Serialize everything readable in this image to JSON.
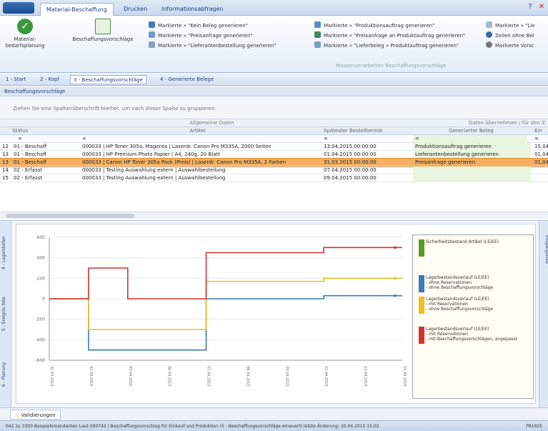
{
  "titlebar": {
    "app_button": "",
    "tabs": [
      "Material-Beschaffung",
      "Drucken",
      "Informationsabfragen"
    ],
    "help_icon": "help-icon",
    "close_icon": "close-icon"
  },
  "ribbon": {
    "big_buttons": [
      {
        "label": "Material-\nbedarfsplanung",
        "icon": "check-icon",
        "color": "#3a9a3a"
      },
      {
        "label": "Beschaffungsvorschläge",
        "icon": "proposal-icon",
        "color": "#4a8a3a"
      }
    ],
    "commands_col1": [
      "Markierte » \"Kein Beleg generieren\"",
      "Markierte » \"Preisanfrage generieren\"",
      "Markierte » \"Lieferantenbestellung generieren\""
    ],
    "commands_col2": [
      "Markierte » \"Produktionsauftrag generieren\"",
      "Markierte » \"Preisanfrage an Produktauftrag generieren\"",
      "Markierte » \"Lieferbeleg » Produktauftrag generieren\""
    ],
    "commands_col3": [
      "Markierte » \"Lie",
      "Zeilen ohne Bel",
      "Markierte Vorsc"
    ],
    "group_caption": "Massenverarbeiten Beschaffungsvorschläge"
  },
  "navbar": {
    "tabs": [
      "1 - Start",
      "2 - Kopf",
      "3 - Beschaffungsvorschläge",
      "4 - Generierte Belege"
    ],
    "active": 2
  },
  "section_title": "Beschaffungsvorschläge",
  "group_hint": "Ziehen Sie eine Spaltenüberschrift hierher, um nach dieser Spalte zu gruppieren.",
  "grid": {
    "band_headers": [
      "Allgemeine Daten",
      "Daten übernehmen / für den Z"
    ],
    "columns": [
      "Status",
      "Artikel",
      "Spätester Bestelltermin",
      "Generierter Beleg",
      "Ein"
    ],
    "filter_symbols": [
      "=",
      "=",
      "=",
      "=",
      "="
    ],
    "rows": [
      {
        "num": "12",
        "status": "01 - Beschaff",
        "article": "000033 | HP Toner 305a, Magenta | Laserdr. Canon Pro M335A, 2000 Seiten",
        "date": "13.04.2015 00:00:00",
        "doc": "Produktionsauftrag generieren",
        "ein": "15.04."
      },
      {
        "num": "13",
        "status": "01 - Beschaff",
        "article": "000033 | HP Premium Photo Papier | A4, 240g, 20 Blatt",
        "date": "01.04.2015 00:00:00",
        "doc": "Lieferantenbestellung generieren",
        "ein": "01.04."
      },
      {
        "num": "13",
        "status": "01 - Beschaff",
        "article": "000033 | Canon HP Toner 305a Pack (Preis) | Laserdr. Canon Pro M335A, 2 Farben",
        "date": "31.03.2015 00:00:00",
        "doc": "Preisanfrage generieren",
        "ein": "01.04."
      },
      {
        "num": "14",
        "status": "02 - Erfasst",
        "article": "000033 | Testing Auswahlung extern | Auswahlbestellung",
        "date": "07.04.2015 00:00:00",
        "doc": "",
        "ein": ""
      },
      {
        "num": "15",
        "status": "02 - Erfasst",
        "article": "000033 | Testing Auswahlung extern | Auswahlbestellung",
        "date": "09.04.2015 00:00:00",
        "doc": "",
        "ein": ""
      }
    ]
  },
  "side_tabs": [
    "4 - Lagerstellen",
    "5 - Ereignis liste",
    "6 - Planung"
  ],
  "right_tab": "Eingangsliste",
  "chart_data": {
    "type": "line",
    "x": [
      "31.03.2015",
      "01.04.2015",
      "03.04.2015",
      "06.04.2015",
      "07.04.2015",
      "08.04.2015",
      "09.04.2015",
      "11.04.2015",
      "13.04.2015",
      "15.04.2015"
    ],
    "ylim": [
      -600,
      600
    ],
    "yticks": [
      -600,
      -400,
      -200,
      0,
      200,
      400,
      600
    ],
    "series": [
      {
        "name": "Sicherheitsbestand Artikel (LE/EE)",
        "color": "#5a9a2a",
        "values": []
      },
      {
        "name": "Lagerbestandsverlauf (LE/EE)\n- ohne Reservationen\n- ohne Beschaffungsvorschläge",
        "color": "#3a7ab8",
        "values": [
          0,
          -500,
          -500,
          -500,
          0,
          0,
          0,
          30,
          30,
          30
        ]
      },
      {
        "name": "Lagerbestandsverlauf (LE/EE)\n- mit Reservationen\n- ohne Beschaffungsvorschläge",
        "color": "#e8c020",
        "values": [
          0,
          -300,
          -300,
          -300,
          170,
          170,
          170,
          200,
          200,
          200
        ]
      },
      {
        "name": "Lagerbestandsverlauf (LE/EE)\n- mit Reservationen\n- mit Beschaffungsvorschlägen, angepasst",
        "color": "#d83030",
        "values": [
          0,
          300,
          0,
          0,
          450,
          450,
          450,
          500,
          500,
          500
        ]
      }
    ]
  },
  "bottom_tab": "Validierungen",
  "statusbar": "042 2x 3300 Beispielsmandanten Laut 000742 | Beschaffungsvorschlag für Einkauf und Produktion  (5 - Beschaffungsvorschläge erneuert)  letzte Änderung: 20.04.2015 15:02",
  "status_right": "P81925"
}
